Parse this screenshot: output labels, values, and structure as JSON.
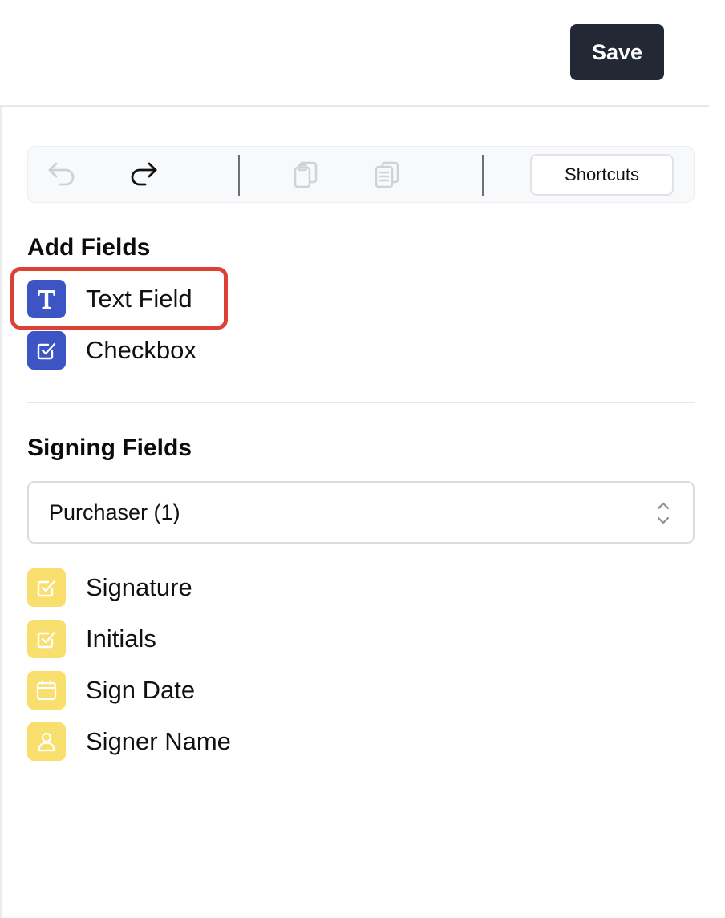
{
  "header": {
    "save_label": "Save"
  },
  "toolbar": {
    "shortcuts_label": "Shortcuts",
    "buttons": [
      {
        "name": "undo-icon",
        "enabled": false
      },
      {
        "name": "redo-icon",
        "enabled": true
      },
      {
        "name": "copy-icon",
        "enabled": false
      },
      {
        "name": "paste-icon",
        "enabled": false
      }
    ]
  },
  "add_fields": {
    "title": "Add Fields",
    "items": [
      {
        "label": "Text Field",
        "icon": "text-t-icon",
        "highlighted": true
      },
      {
        "label": "Checkbox",
        "icon": "checkbox-icon"
      }
    ]
  },
  "signing_fields": {
    "title": "Signing Fields",
    "signer_select": {
      "value": "Purchaser (1)"
    },
    "items": [
      {
        "label": "Signature",
        "icon": "checkbox-icon"
      },
      {
        "label": "Initials",
        "icon": "checkbox-icon"
      },
      {
        "label": "Sign Date",
        "icon": "calendar-icon"
      },
      {
        "label": "Signer Name",
        "icon": "user-icon"
      }
    ]
  },
  "colors": {
    "primary_dark": "#222834",
    "field_blue": "#3d55c4",
    "field_yellow": "#f8df6e",
    "highlight_red": "#dc4136"
  }
}
